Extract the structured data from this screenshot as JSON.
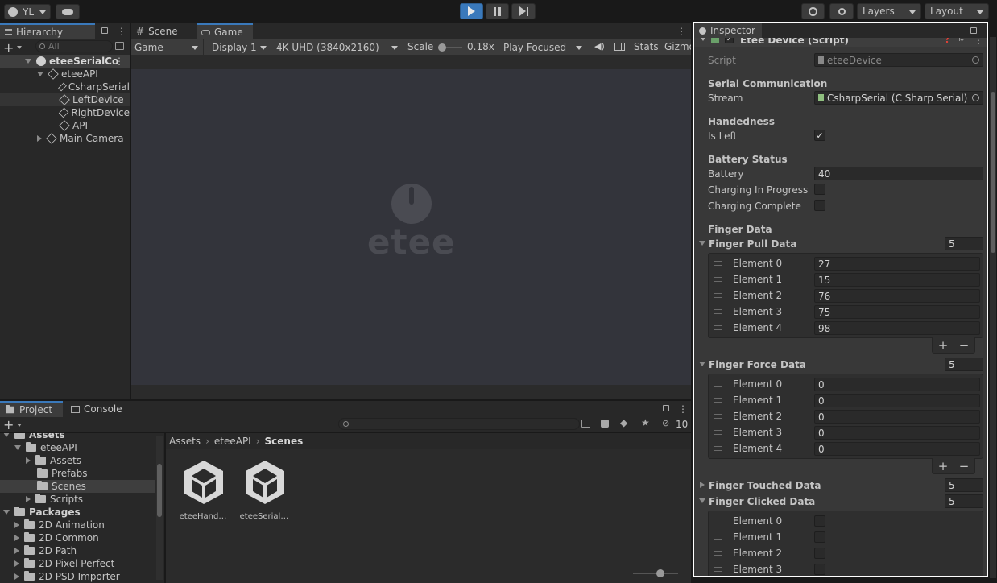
{
  "topbar": {
    "account": "YL",
    "layers": "Layers",
    "layout": "Layout"
  },
  "hierarchy": {
    "tab": "Hierarchy",
    "search_placeholder": "All",
    "scene": "eteeSerialCo",
    "items": [
      "eteeAPI",
      "CsharpSerial",
      "LeftDevice",
      "RightDevice",
      "API",
      "Main Camera"
    ]
  },
  "game": {
    "tabs": [
      "Scene",
      "Game"
    ],
    "game_select": "Game",
    "display": "Display 1",
    "resolution": "4K UHD (3840x2160)",
    "scale_label": "Scale",
    "scale_value": "0.18x",
    "play_focused": "Play Focused",
    "stats": "Stats",
    "gizmos": "Gizmo",
    "logo_text": "etee"
  },
  "project": {
    "tabs": [
      "Project",
      "Console"
    ],
    "hidden_count": "10",
    "tree": [
      {
        "label": "Assets",
        "depth": 0,
        "expanded": true,
        "bold": true
      },
      {
        "label": "eteeAPI",
        "depth": 1,
        "expanded": true
      },
      {
        "label": "Assets",
        "depth": 2,
        "expanded": false
      },
      {
        "label": "Prefabs",
        "depth": 2,
        "expanded": null
      },
      {
        "label": "Scenes",
        "depth": 2,
        "expanded": null,
        "selected": true
      },
      {
        "label": "Scripts",
        "depth": 2,
        "expanded": false
      },
      {
        "label": "Packages",
        "depth": 0,
        "expanded": true,
        "bold": true
      },
      {
        "label": "2D Animation",
        "depth": 1,
        "expanded": false
      },
      {
        "label": "2D Common",
        "depth": 1,
        "expanded": false
      },
      {
        "label": "2D Path",
        "depth": 1,
        "expanded": false
      },
      {
        "label": "2D Pixel Perfect",
        "depth": 1,
        "expanded": false
      },
      {
        "label": "2D PSD Importer",
        "depth": 1,
        "expanded": false
      }
    ],
    "breadcrumb": [
      "Assets",
      "eteeAPI",
      "Scenes"
    ],
    "assets": [
      "eteeHand…",
      "eteeSerial…"
    ]
  },
  "inspector": {
    "tab": "Inspector",
    "component_title": "Etee Device (Script)",
    "script_label": "Script",
    "script_value": "eteeDevice",
    "serial_header": "Serial Communication",
    "stream_label": "Stream",
    "stream_value": "CsharpSerial (C Sharp Serial)",
    "handedness_header": "Handedness",
    "is_left_label": "Is Left",
    "battery_header": "Battery Status",
    "battery_label": "Battery",
    "battery_value": "40",
    "charging_label": "Charging In Progress",
    "complete_label": "Charging Complete",
    "finger_header": "Finger Data",
    "pull": {
      "label": "Finger Pull Data",
      "size": "5",
      "elements": [
        "Element 0",
        "Element 1",
        "Element 2",
        "Element 3",
        "Element 4"
      ],
      "values": [
        "27",
        "15",
        "76",
        "75",
        "98"
      ]
    },
    "force": {
      "label": "Finger Force Data",
      "size": "5",
      "elements": [
        "Element 0",
        "Element 1",
        "Element 2",
        "Element 3",
        "Element 4"
      ],
      "values": [
        "0",
        "0",
        "0",
        "0",
        "0"
      ]
    },
    "touched": {
      "label": "Finger Touched Data",
      "size": "5"
    },
    "clicked": {
      "label": "Finger Clicked Data",
      "size": "5",
      "elements": [
        "Element 0",
        "Element 1",
        "Element 2",
        "Element 3"
      ]
    },
    "plus": "+",
    "minus": "−"
  }
}
